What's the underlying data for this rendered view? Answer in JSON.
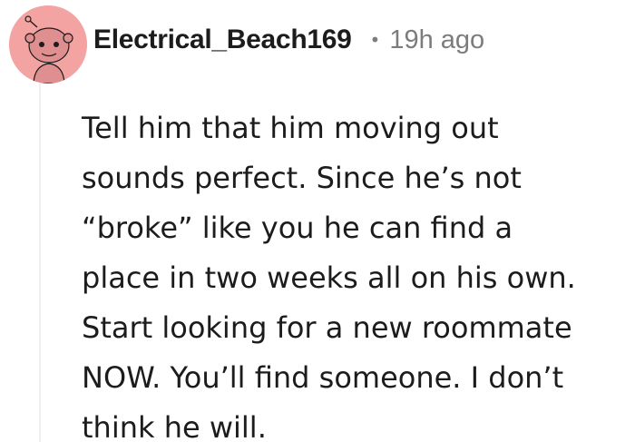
{
  "comment": {
    "author": "Electrical_Beach169",
    "separator": "•",
    "timestamp": "19h ago",
    "avatar_icon": "snoo-avatar-icon",
    "avatar_color": "#f4a3a3",
    "body_lines": [
      "Tell him that him moving out",
      "sounds perfect. Since he’s not",
      "“broke” like you he can find a",
      "place in two weeks all on his own.",
      "Start looking for a new roommate",
      "NOW. You’ll find someone. I don’t",
      "think he will."
    ]
  }
}
